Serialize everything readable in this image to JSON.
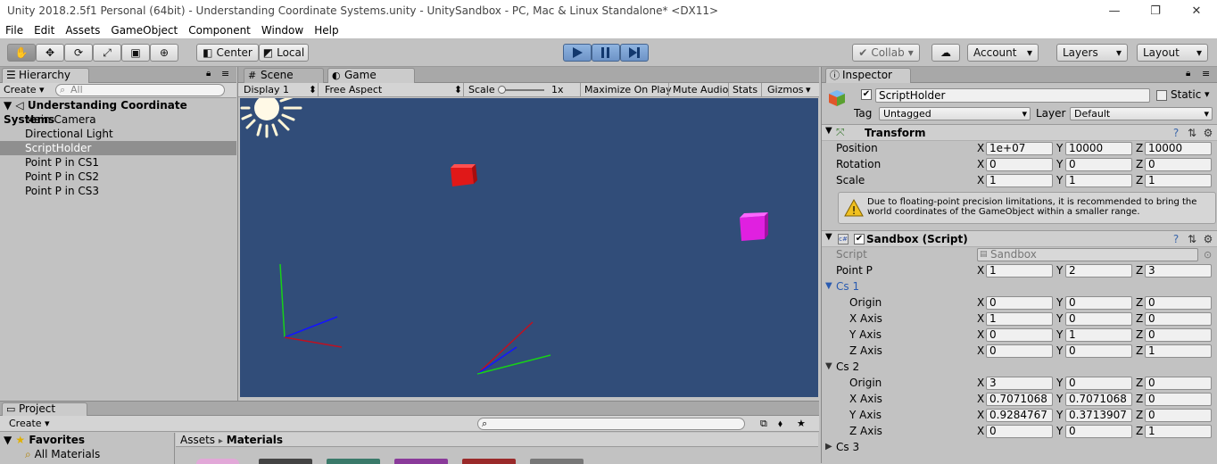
{
  "window": {
    "title": "Unity 2018.2.5f1 Personal (64bit) - Understanding Coordinate Systems.unity - UnitySandbox - PC, Mac & Linux Standalone* <DX11>",
    "minimize": "—",
    "restore": "❐",
    "close": "✕"
  },
  "menu": [
    "File",
    "Edit",
    "Assets",
    "GameObject",
    "Component",
    "Window",
    "Help"
  ],
  "toolbar": {
    "center_label": "Center",
    "local_label": "Local",
    "collab_label": "Collab",
    "account_label": "Account",
    "layers_label": "Layers",
    "layout_label": "Layout"
  },
  "hierarchy": {
    "tab": "Hierarchy",
    "create": "Create",
    "search_placeholder": "All",
    "scene_name": "Understanding Coordinate Systems",
    "items": [
      "Main Camera",
      "Directional Light",
      "ScriptHolder",
      "Point P in CS1",
      "Point P in CS2",
      "Point P in CS3"
    ],
    "selected_index": 2
  },
  "game": {
    "scene_tab": "Scene",
    "game_tab": "Game",
    "display": "Display 1",
    "aspect": "Free Aspect",
    "scale_label": "Scale",
    "scale_value": "1x",
    "maximize": "Maximize On Play",
    "mute": "Mute Audio",
    "stats": "Stats",
    "gizmos": "Gizmos",
    "colors": {
      "background": "#314d79",
      "red_cube": "#e01818",
      "magenta_cube": "#e020e0"
    }
  },
  "inspector": {
    "tab": "Inspector",
    "object_name": "ScriptHolder",
    "static_label": "Static",
    "tag_label": "Tag",
    "tag_value": "Untagged",
    "layer_label": "Layer",
    "layer_value": "Default",
    "transform": {
      "title": "Transform",
      "position": {
        "label": "Position",
        "x": "1e+07",
        "y": "10000",
        "z": "10000"
      },
      "rotation": {
        "label": "Rotation",
        "x": "0",
        "y": "0",
        "z": "0"
      },
      "scale": {
        "label": "Scale",
        "x": "1",
        "y": "1",
        "z": "1"
      },
      "warning": "Due to floating-point precision limitations, it is recommended to bring the world coordinates of the GameObject within a smaller range."
    },
    "sandbox": {
      "title": "Sandbox (Script)",
      "script_label": "Script",
      "script_value": "Sandbox",
      "pointp": {
        "label": "Point P",
        "x": "1",
        "y": "2",
        "z": "3"
      },
      "cs1": {
        "label": "Cs 1",
        "origin": {
          "label": "Origin",
          "x": "0",
          "y": "0",
          "z": "0"
        },
        "xaxis": {
          "label": "X Axis",
          "x": "1",
          "y": "0",
          "z": "0"
        },
        "yaxis": {
          "label": "Y Axis",
          "x": "0",
          "y": "1",
          "z": "0"
        },
        "zaxis": {
          "label": "Z Axis",
          "x": "0",
          "y": "0",
          "z": "1"
        }
      },
      "cs2": {
        "label": "Cs 2",
        "origin": {
          "label": "Origin",
          "x": "3",
          "y": "0",
          "z": "0"
        },
        "xaxis": {
          "label": "X Axis",
          "x": "0.7071068",
          "y": "0.7071068",
          "z": "0"
        },
        "yaxis": {
          "label": "Y Axis",
          "x": "0.9284767",
          "y": "0.3713907",
          "z": "0"
        },
        "zaxis": {
          "label": "Z Axis",
          "x": "0",
          "y": "0",
          "z": "1"
        }
      },
      "cs3": {
        "label": "Cs 3"
      }
    },
    "axis_x": "X",
    "axis_y": "Y",
    "axis_z": "Z"
  },
  "project": {
    "tab": "Project",
    "create": "Create",
    "favorites": "Favorites",
    "all_materials": "All Materials",
    "breadcrumb_root": "Assets",
    "breadcrumb_sep": "▸",
    "breadcrumb_current": "Materials"
  }
}
